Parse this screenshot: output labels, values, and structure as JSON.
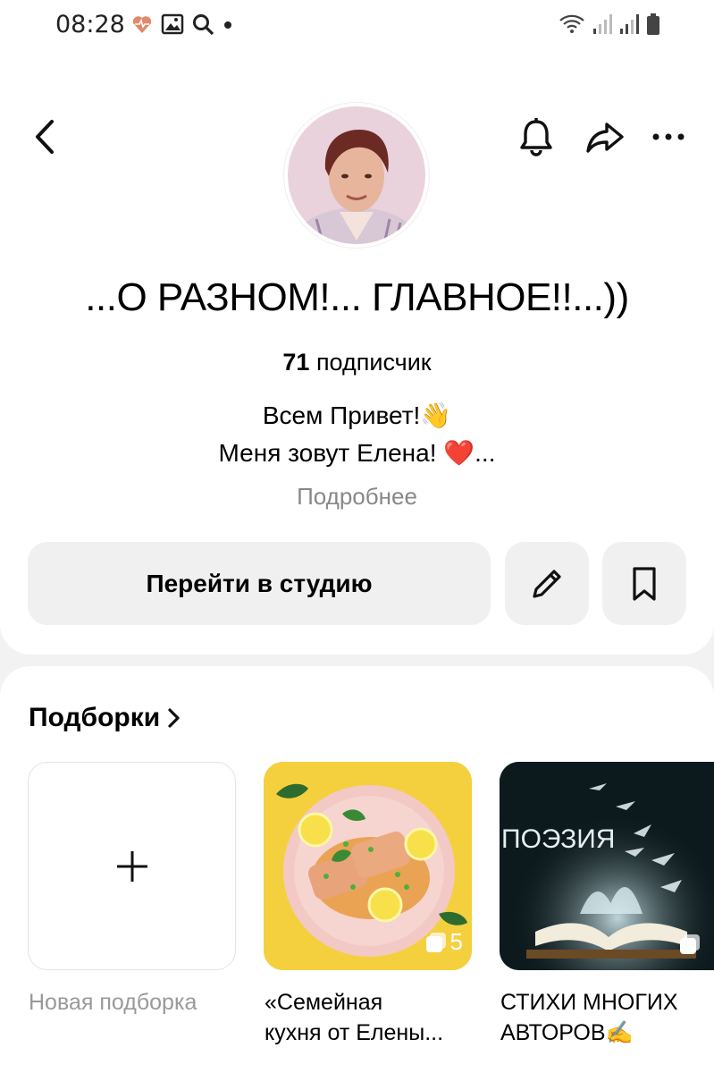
{
  "status_bar": {
    "time": "08:28",
    "left_icons": [
      "health-heart-icon",
      "gallery-icon",
      "search-icon",
      "dot-icon"
    ],
    "right_icons": [
      "wifi-icon",
      "signal-icon",
      "signal-icon",
      "battery-icon"
    ]
  },
  "header": {
    "back_icon": "chevron-left-icon",
    "bell_icon": "bell-icon",
    "share_icon": "share-icon",
    "more_icon": "more-dots-icon"
  },
  "profile": {
    "title": "...О РАЗНОМ!... ГЛАВНОЕ!!...))",
    "subscribers_count": "71",
    "subscribers_label": "подписчик",
    "description_line1": "Всем Привет!👋",
    "description_line2": "Меня зовут Елена! ❤️...",
    "more_label": "Подробнее"
  },
  "actions": {
    "studio_label": "Перейти в студию",
    "edit_icon": "pencil-icon",
    "bookmark_icon": "bookmark-icon"
  },
  "collections": {
    "header": "Подборки",
    "items": [
      {
        "label": "Новая подборка"
      },
      {
        "label_line1": "«Семейная",
        "label_line2": "кухня от Елены...",
        "count": "5"
      },
      {
        "image_text": "ПОЭЗИЯ",
        "label_line1": "СТИХИ МНОГИХ",
        "label_line2": "АВТОРОВ✍️"
      }
    ]
  },
  "colors": {
    "accent_yellow": "#f4d03f",
    "button_bg": "#f0f0f0",
    "muted_text": "#888888"
  }
}
